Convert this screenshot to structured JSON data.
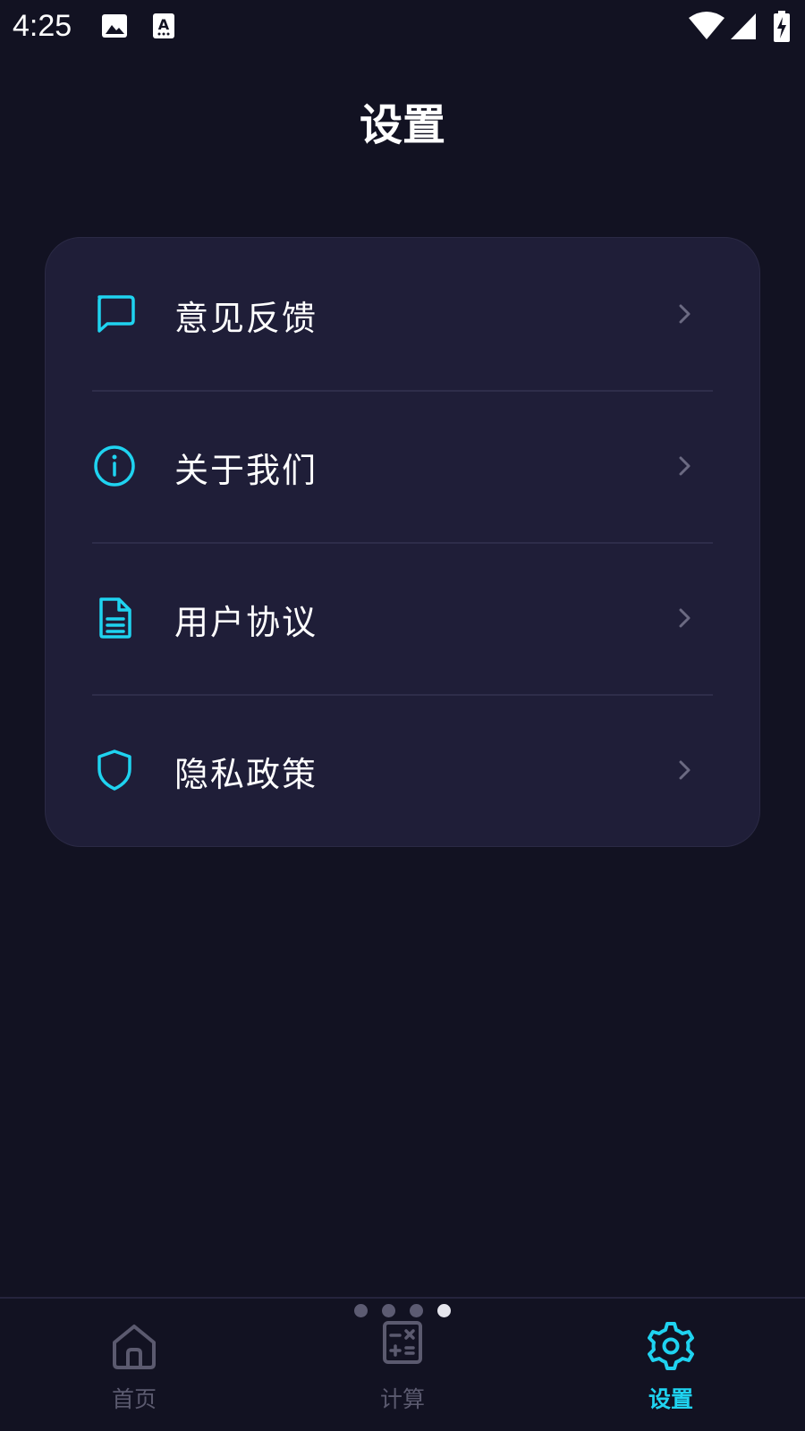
{
  "status_bar": {
    "time": "4:25",
    "icons": [
      "image-icon",
      "text-accessibility-icon",
      "wifi-icon",
      "cellular-signal-icon",
      "battery-charging-icon"
    ]
  },
  "header": {
    "title": "设置"
  },
  "settings": {
    "items": [
      {
        "label": "意见反馈",
        "icon": "feedback-chat-icon"
      },
      {
        "label": "关于我们",
        "icon": "info-icon"
      },
      {
        "label": "用户协议",
        "icon": "document-icon"
      },
      {
        "label": "隐私政策",
        "icon": "shield-icon"
      }
    ]
  },
  "pager": {
    "count": 4,
    "active_index": 3
  },
  "bottom_nav": {
    "items": [
      {
        "label": "首页",
        "icon": "home-icon",
        "active": false
      },
      {
        "label": "计算",
        "icon": "calculator-icon",
        "active": false
      },
      {
        "label": "设置",
        "icon": "gear-icon",
        "active": true
      }
    ]
  },
  "colors": {
    "background": "#121222",
    "card": "#1f1e38",
    "accent": "#1fd3f0",
    "inactive": "#5b5a6f",
    "chevron": "#6b6a82"
  }
}
